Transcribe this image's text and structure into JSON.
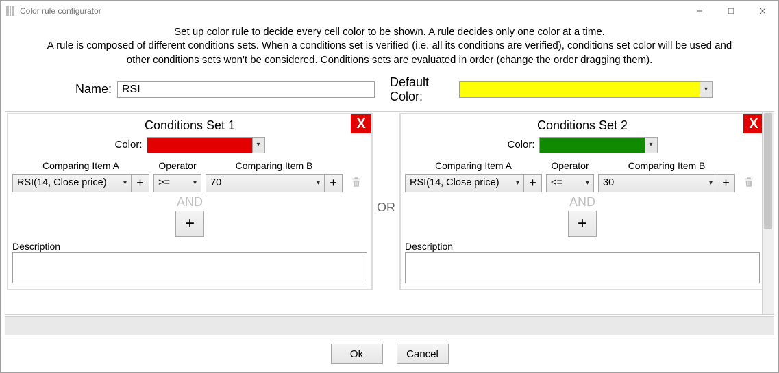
{
  "window": {
    "title": "Color rule configurator"
  },
  "instructions": {
    "line1": "Set up color rule to decide every cell color to be shown. A rule decides only one color at a time.",
    "line2": "A rule is composed of different conditions sets. When a conditions set is verified (i.e. all its conditions are verified), conditions set color will be used and",
    "line3": "other conditions sets won't be considered. Conditions sets are evaluated in order (change the order dragging them)."
  },
  "name_label": "Name:",
  "name_value": "RSI",
  "default_color_label": "Default Color:",
  "default_color": "#ffff06",
  "or_word": "OR",
  "and_word": "AND",
  "headers": {
    "item_a": "Comparing Item A",
    "operator": "Operator",
    "item_b": "Comparing Item B"
  },
  "color_field_label": "Color:",
  "description_label": "Description",
  "sets": [
    {
      "title": "Conditions Set 1",
      "close": "X",
      "color": "#e30000",
      "rows": [
        {
          "item_a": "RSI(14, Close price)",
          "operator": ">=",
          "item_b": "70"
        }
      ],
      "description": ""
    },
    {
      "title": "Conditions Set 2",
      "close": "X",
      "color": "#108a00",
      "rows": [
        {
          "item_a": "RSI(14, Close price)",
          "operator": "<=",
          "item_b": "30"
        }
      ],
      "description": ""
    }
  ],
  "footer": {
    "ok": "Ok",
    "cancel": "Cancel"
  }
}
